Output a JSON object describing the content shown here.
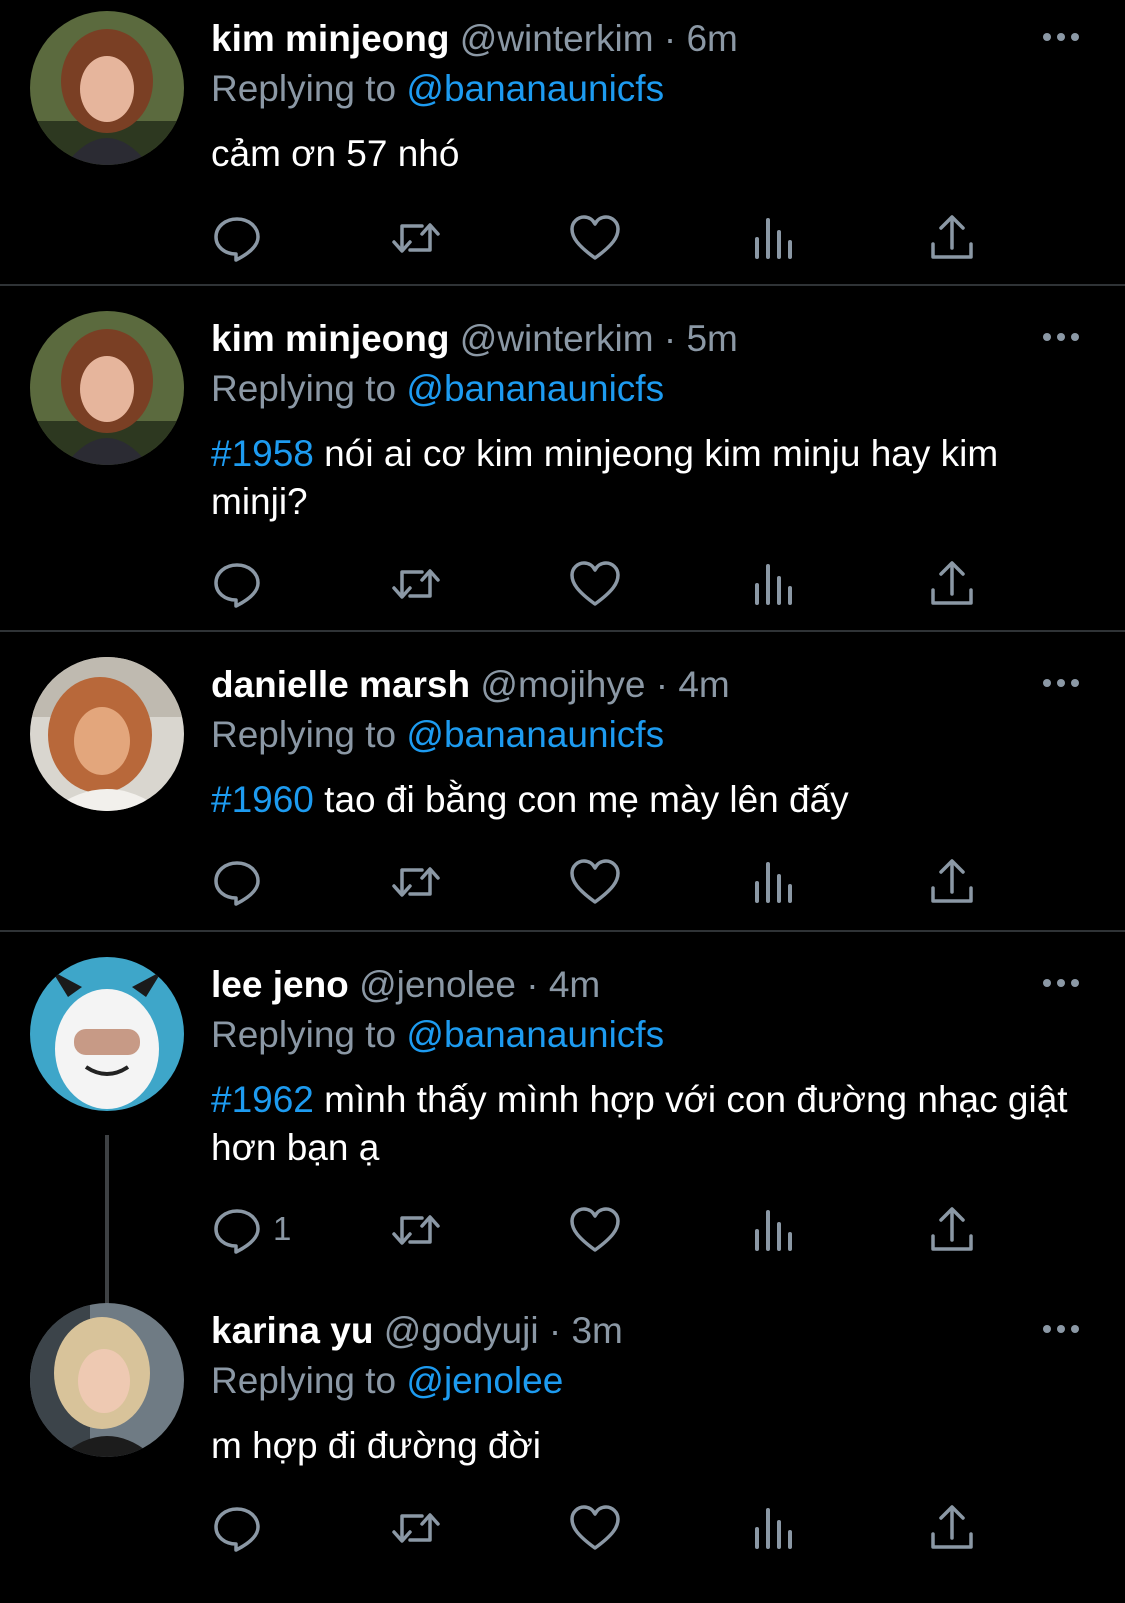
{
  "tweets": [
    {
      "name": "kim minjeong",
      "handle": "@winterkim",
      "dot": "·",
      "time": "6m",
      "replying_prefix": "Replying to",
      "replying_to": "@bananaunicfs",
      "tag": "",
      "text": "cảm ơn 57 nhó",
      "reply_count": ""
    },
    {
      "name": "kim minjeong",
      "handle": "@winterkim",
      "dot": "·",
      "time": "5m",
      "replying_prefix": "Replying to",
      "replying_to": "@bananaunicfs",
      "tag": "#1958",
      "text": " nói ai cơ kim minjeong kim minju hay kim minji?",
      "reply_count": ""
    },
    {
      "name": "danielle marsh",
      "handle": "@mojihye",
      "dot": "·",
      "time": "4m",
      "replying_prefix": "Replying to",
      "replying_to": "@bananaunicfs",
      "tag": "#1960",
      "text": " tao đi bằng con mẹ mày lên đấy",
      "reply_count": ""
    },
    {
      "name": "lee jeno",
      "handle": "@jenolee",
      "dot": "·",
      "time": "4m",
      "replying_prefix": "Replying to",
      "replying_to": "@bananaunicfs",
      "tag": "#1962",
      "text": " mình thấy mình hợp với con đường nhạc giật hơn bạn ạ",
      "reply_count": "1"
    },
    {
      "name": "karina yu",
      "handle": "@godyuji",
      "dot": "·",
      "time": "3m",
      "replying_prefix": "Replying to",
      "replying_to": "@jenolee",
      "tag": "",
      "text": "m hợp đi đường đời",
      "reply_count": ""
    }
  ],
  "icons": {
    "reply": "reply-icon",
    "retweet": "retweet-icon",
    "like": "heart-icon",
    "views": "views-icon",
    "share": "share-icon",
    "more": "more-icon"
  },
  "colors": {
    "background": "#000000",
    "accent": "#1d9bf0",
    "muted": "#8b98a5",
    "divider": "#2f3336"
  }
}
